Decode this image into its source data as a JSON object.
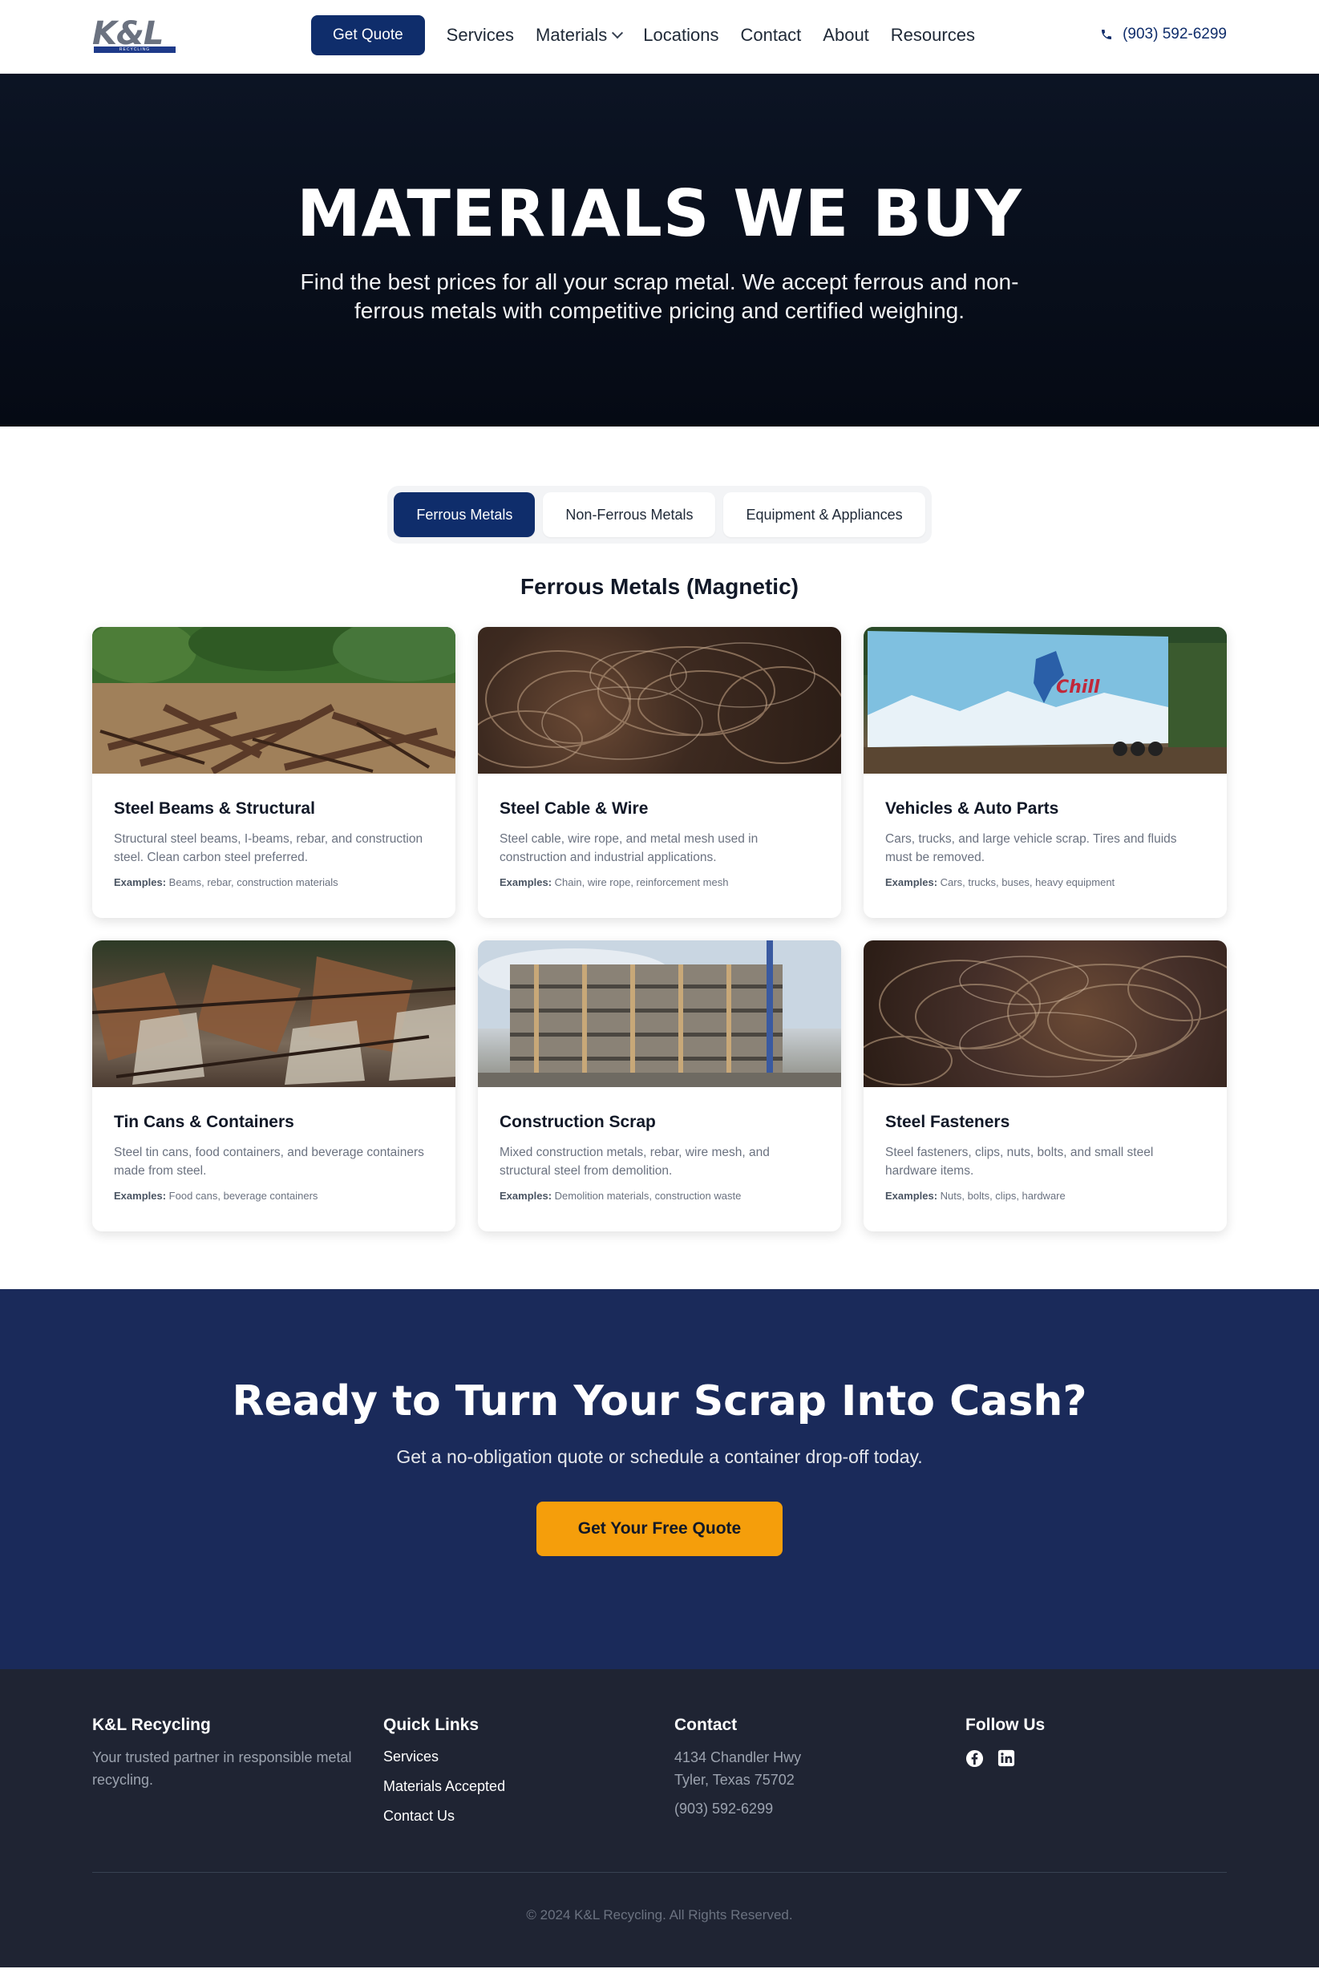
{
  "nav": {
    "logo_text": "K&L",
    "logo_sub": "RECYCLING",
    "quote_button": "Get Quote",
    "items": [
      "Services",
      "Materials",
      "Locations",
      "Contact",
      "About",
      "Resources"
    ],
    "phone": "(903) 592-6299"
  },
  "hero": {
    "title": "MATERIALS WE BUY",
    "subtitle": "Find the best prices for all your scrap metal. We accept ferrous and non-ferrous metals with competitive pricing and certified weighing."
  },
  "tabs": {
    "active": "Ferrous Metals",
    "items": [
      "Ferrous Metals",
      "Non-Ferrous Metals",
      "Equipment & Appliances"
    ]
  },
  "section": {
    "title": "Ferrous Metals (Magnetic)"
  },
  "examples_label": "Examples:",
  "cards": [
    {
      "title": "Steel Beams & Structural",
      "desc": "Structural steel beams, I-beams, rebar, and construction steel. Clean carbon steel preferred.",
      "examples": "Beams, rebar, construction materials"
    },
    {
      "title": "Steel Cable & Wire",
      "desc": "Steel cable, wire rope, and metal mesh used in construction and industrial applications.",
      "examples": "Chain, wire rope, reinforcement mesh"
    },
    {
      "title": "Vehicles & Auto Parts",
      "desc": "Cars, trucks, and large vehicle scrap. Tires and fluids must be removed.",
      "examples": "Cars, trucks, buses, heavy equipment"
    },
    {
      "title": "Tin Cans & Containers",
      "desc": "Steel tin cans, food containers, and beverage containers made from steel.",
      "examples": "Food cans, beverage containers"
    },
    {
      "title": "Construction Scrap",
      "desc": "Mixed construction metals, rebar, wire mesh, and structural steel from demolition.",
      "examples": "Demolition materials, construction waste"
    },
    {
      "title": "Steel Fasteners",
      "desc": "Steel fasteners, clips, nuts, bolts, and small steel hardware items.",
      "examples": "Nuts, bolts, clips, hardware"
    }
  ],
  "trailer_text": "Chill",
  "cta": {
    "title": "Ready to Turn Your Scrap Into Cash?",
    "subtitle": "Get a no-obligation quote or schedule a container drop-off today.",
    "button": "Get Your Free Quote"
  },
  "footer": {
    "about_title": "K&L Recycling",
    "about_text": "Your trusted partner in responsible metal recycling.",
    "links_title": "Quick Links",
    "links": [
      "Services",
      "Materials Accepted",
      "Contact Us"
    ],
    "contact_title": "Contact",
    "address1": "4134 Chandler Hwy",
    "address2": "Tyler, Texas 75702",
    "phone": "(903) 592-6299",
    "follow_title": "Follow Us",
    "copyright": "© 2024 K&L Recycling. All Rights Reserved."
  },
  "icons": {
    "phone": "phone-icon",
    "facebook": "facebook-icon",
    "linkedin": "linkedin-icon",
    "chevron": "chevron-down-icon"
  },
  "colors": {
    "brand_navy": "#0f2d6b",
    "cta_bg": "#1a2a5a",
    "accent_orange": "#f59e0b",
    "footer_bg": "#1f2433"
  }
}
